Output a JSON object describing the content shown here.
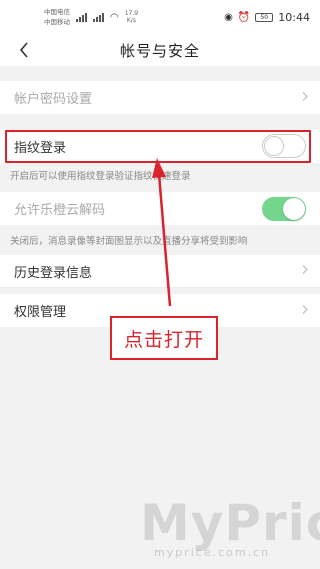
{
  "status_bar": {
    "carrier_1": "中国电信",
    "carrier_2": "中国移动",
    "speed": "17.9",
    "speed_unit": "K/s",
    "time": "10:44",
    "battery": "50"
  },
  "header": {
    "title": "帐号与安全"
  },
  "rows": {
    "password": "帐户密码设置",
    "fingerprint": "指纹登录",
    "cloud": "允许乐橙云解码",
    "history": "历史登录信息",
    "permission": "权限管理"
  },
  "hints": {
    "fingerprint": "开启后可以使用指纹登录验证指纹快速登录",
    "cloud": "关闭后，消息录像等封面图显示以及直播分享将受到影响"
  },
  "toggles": {
    "fingerprint": false,
    "cloud": true
  },
  "callout": {
    "text": "点击打开"
  },
  "watermark": {
    "big": "MyPrice",
    "small": "myprice.com.cn"
  },
  "colors": {
    "accent_red": "#d9232d",
    "toggle_on": "#74d68c"
  }
}
